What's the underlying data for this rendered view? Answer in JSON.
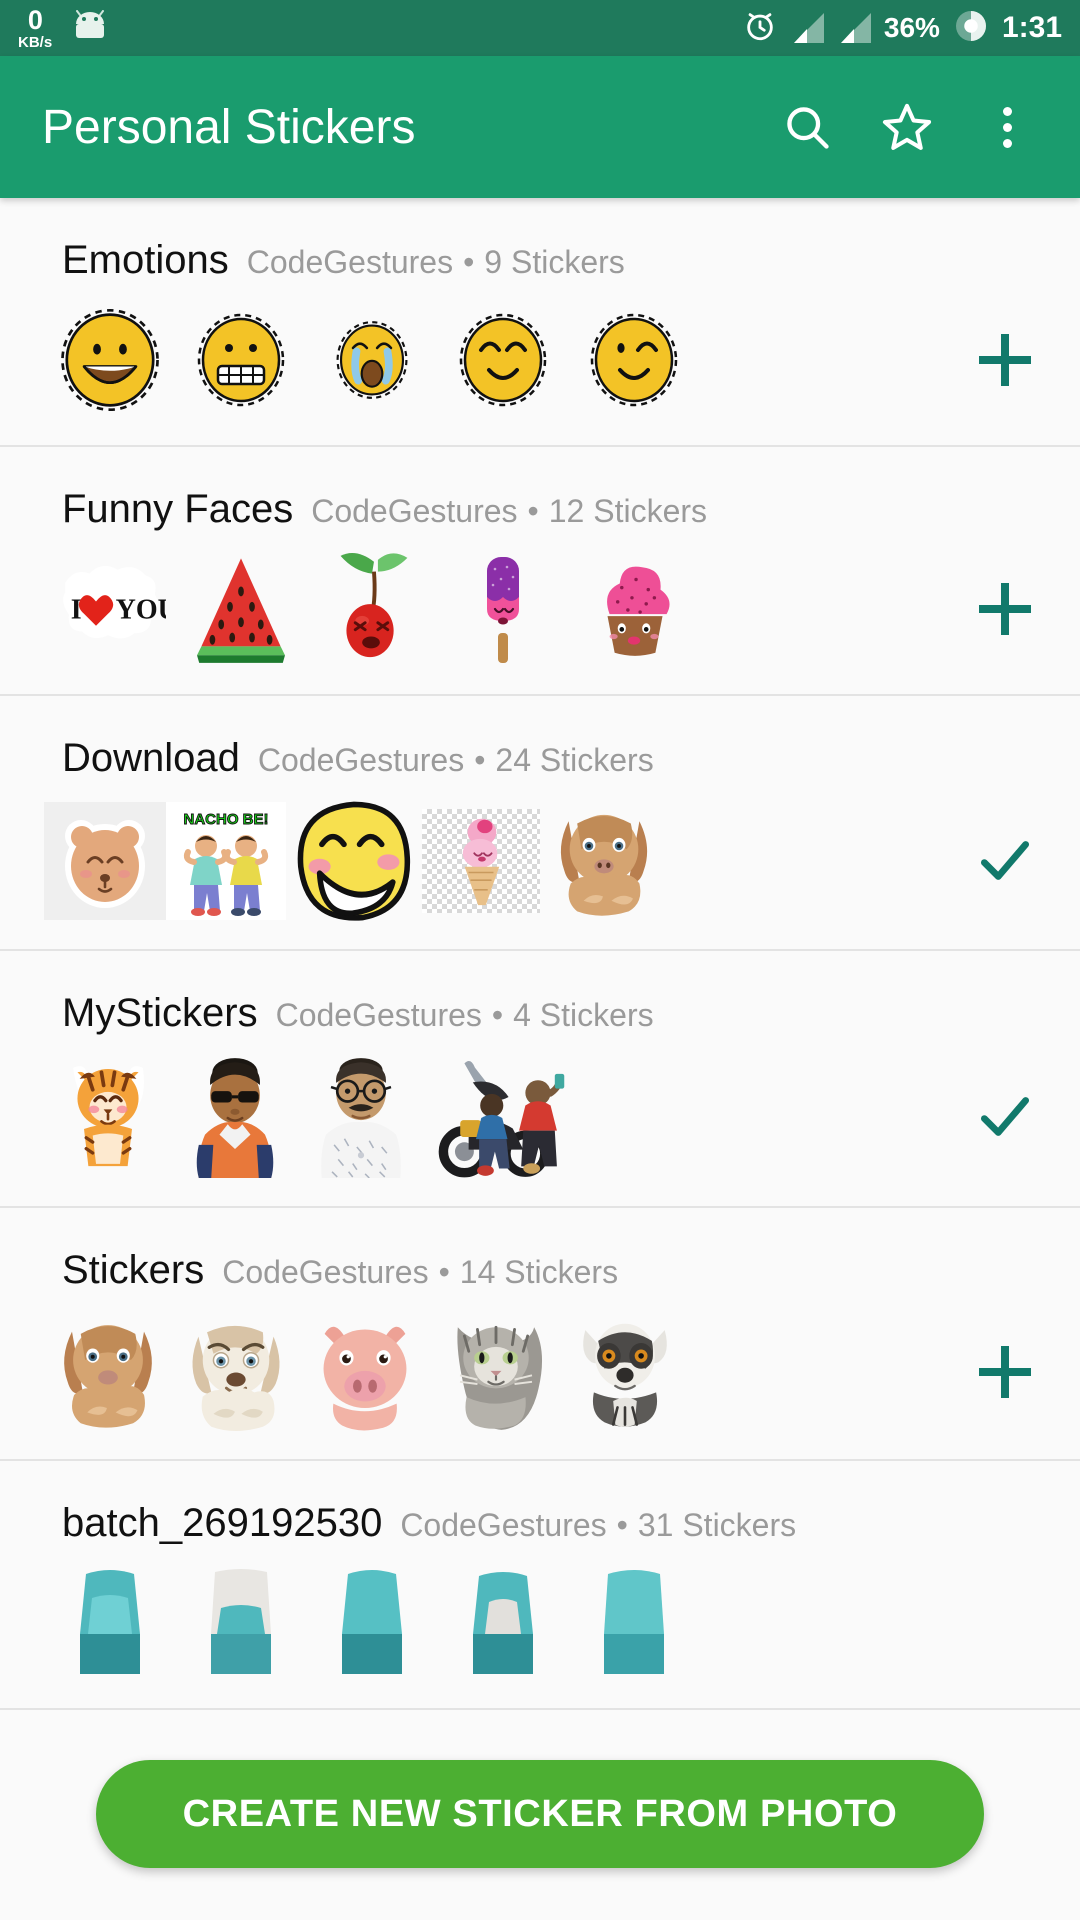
{
  "status_bar": {
    "net_speed_value": "0",
    "net_speed_unit": "KB/s",
    "android_icon": "android-robot-icon",
    "alarm_icon": "alarm-clock-icon",
    "signal_icon_1": "signal-bars-icon",
    "signal_icon_2": "signal-bars-icon",
    "battery_percent": "36%",
    "battery_icon": "battery-circle-icon",
    "time": "1:31"
  },
  "app_bar": {
    "title": "Personal Stickers",
    "search_icon": "search-icon",
    "star_icon": "star-icon",
    "overflow_icon": "more-vertical-icon",
    "background": "#1a9c6e"
  },
  "colors": {
    "accent": "#11796b",
    "app_bar_green": "#1a9c6e",
    "status_bar_green": "#1f7a5c",
    "cta_green": "#4caf32",
    "title_text": "#111111",
    "meta_text": "#9a9a9a"
  },
  "packs": [
    {
      "title": "Emotions",
      "publisher": "CodeGestures",
      "separator": "•",
      "count": "9 Stickers",
      "action": "add",
      "action_icon": "plus-icon",
      "stickers": [
        {
          "name": "grinning-face-sticker",
          "kind": "emoji",
          "variant": "grin"
        },
        {
          "name": "grimacing-face-sticker",
          "kind": "emoji",
          "variant": "grimace"
        },
        {
          "name": "crying-face-sticker",
          "kind": "emoji",
          "variant": "cry"
        },
        {
          "name": "smiling-face-sticker",
          "kind": "emoji",
          "variant": "smile"
        },
        {
          "name": "winking-face-sticker",
          "kind": "emoji",
          "variant": "wink"
        }
      ]
    },
    {
      "title": "Funny Faces",
      "publisher": "CodeGestures",
      "separator": "•",
      "count": "12 Stickers",
      "action": "add",
      "action_icon": "plus-icon",
      "stickers": [
        {
          "name": "i-love-you-sticker",
          "kind": "text",
          "text": "I",
          "text2": "YOU"
        },
        {
          "name": "watermelon-slice-sticker",
          "kind": "watermelon"
        },
        {
          "name": "cherry-face-sticker",
          "kind": "cherry"
        },
        {
          "name": "popsicle-sticker",
          "kind": "popsicle"
        },
        {
          "name": "cupcake-sticker",
          "kind": "cupcake"
        }
      ]
    },
    {
      "title": "Download",
      "publisher": "CodeGestures",
      "separator": "•",
      "count": "24 Stickers",
      "action": "added",
      "action_icon": "check-icon",
      "stickers": [
        {
          "name": "teddy-bear-face-sticker",
          "kind": "bear"
        },
        {
          "name": "nacho-be-sticker",
          "kind": "nacho",
          "text": "NACHO BE!"
        },
        {
          "name": "laughing-face-sticker",
          "kind": "bigsmile"
        },
        {
          "name": "ice-cream-cone-sticker",
          "kind": "icecream"
        },
        {
          "name": "puppy-dog-sticker",
          "kind": "dog-brown"
        }
      ]
    },
    {
      "title": "MyStickers",
      "publisher": "CodeGestures",
      "separator": "•",
      "count": "4 Stickers",
      "action": "added",
      "action_icon": "check-icon",
      "stickers": [
        {
          "name": "tiger-cub-sticker",
          "kind": "tiger"
        },
        {
          "name": "man-sunglasses-photo-sticker",
          "kind": "person-a"
        },
        {
          "name": "man-glasses-photo-sticker",
          "kind": "person-b"
        },
        {
          "name": "motorcycle-group-photo-sticker",
          "kind": "bike"
        }
      ]
    },
    {
      "title": "Stickers",
      "publisher": "CodeGestures",
      "separator": "•",
      "count": "14 Stickers",
      "action": "add",
      "action_icon": "plus-icon",
      "stickers": [
        {
          "name": "brown-dog-sticker",
          "kind": "dog-brown"
        },
        {
          "name": "white-dog-sticker",
          "kind": "dog-white"
        },
        {
          "name": "pig-sticker",
          "kind": "pig"
        },
        {
          "name": "grey-cat-sticker",
          "kind": "cat"
        },
        {
          "name": "lemur-sticker",
          "kind": "lemur"
        }
      ]
    },
    {
      "title": "batch_269192530",
      "publisher": "CodeGestures",
      "separator": "•",
      "count": "31 Stickers",
      "action": "none",
      "action_icon": "",
      "stickers": [
        {
          "name": "teal-figure-sticker",
          "kind": "teal"
        },
        {
          "name": "teal-figure-sticker",
          "kind": "teal"
        },
        {
          "name": "teal-figure-sticker",
          "kind": "teal"
        },
        {
          "name": "teal-figure-sticker",
          "kind": "teal"
        },
        {
          "name": "teal-figure-sticker",
          "kind": "teal"
        }
      ]
    }
  ],
  "cta": {
    "label": "CREATE NEW STICKER FROM PHOTO"
  }
}
